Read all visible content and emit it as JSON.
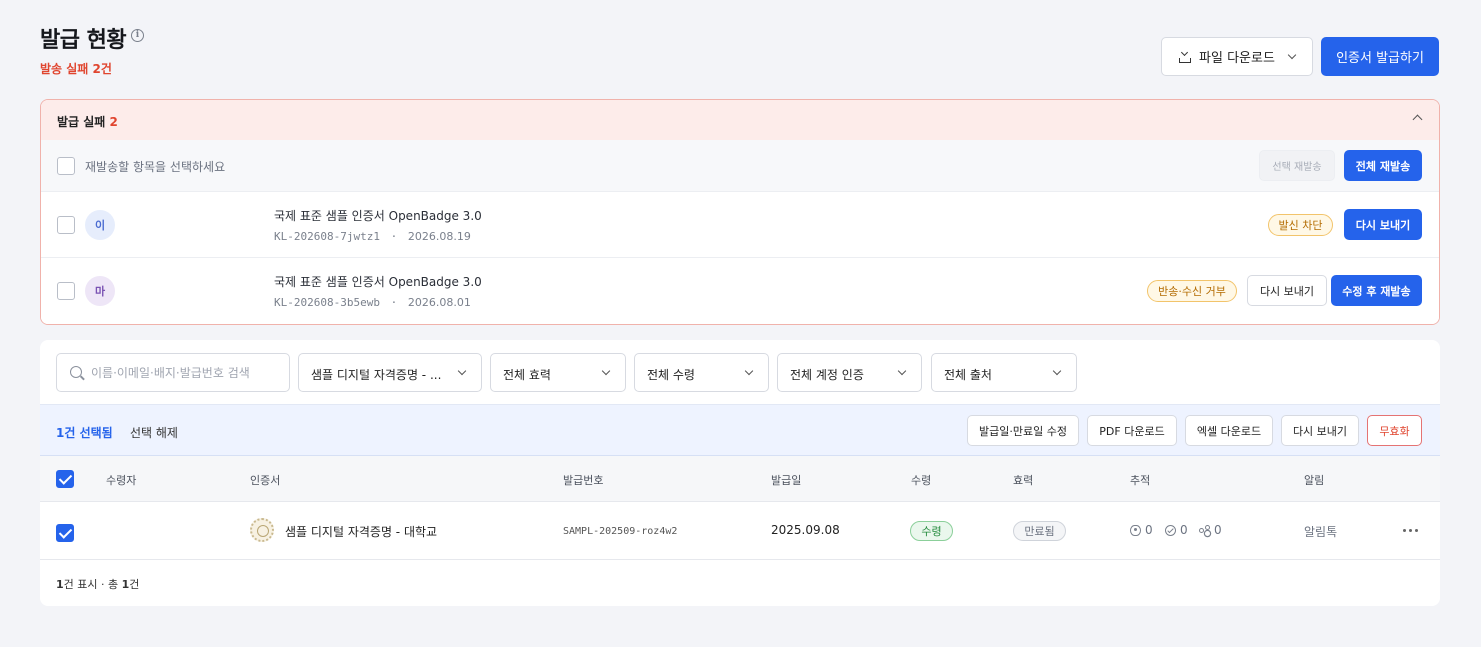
{
  "header": {
    "title": "발급 현황",
    "info_icon": "i",
    "fail_subtitle": "발송 실패 2건",
    "file_download_label": "파일 다운로드",
    "issue_button_label": "인증서 발급하기"
  },
  "fail_panel": {
    "title": "발급 실패",
    "count": "2",
    "select_prompt": "재발송할 항목을 선택하세요",
    "selected_resend_label": "선택 재발송",
    "resend_all_label": "전체 재발송",
    "rows": [
      {
        "avatar": "이",
        "cert_name": "국제 표준 샘플 인증서 OpenBadge 3.0",
        "code": "KL-202608-7jwtz1",
        "separator": "·",
        "date": "2026.08.19",
        "badge": "발신 차단",
        "action_primary": "다시 보내기"
      },
      {
        "avatar": "마",
        "cert_name": "국제 표준 샘플 인증서 OpenBadge 3.0",
        "code": "KL-202608-3b5ewb",
        "separator": "·",
        "date": "2026.08.01",
        "badge": "반송·수신 거부",
        "action_secondary": "다시 보내기",
        "action_primary": "수정 후 재발송"
      }
    ]
  },
  "filters": {
    "search_placeholder": "이름·이메일·배지·발급번호 검색",
    "dropdowns": [
      "샘플 디지털 자격증명 - ...",
      "전체 효력",
      "전체 수령",
      "전체 계정 인증",
      "전체 출처"
    ]
  },
  "selection_bar": {
    "count_label": "1건 선택됨",
    "clear_label": "선택 해제",
    "actions": [
      "발급일·만료일 수정",
      "PDF 다운로드",
      "엑셀 다운로드",
      "다시 보내기",
      "무효화"
    ]
  },
  "table": {
    "columns": [
      "수령자",
      "인증서",
      "발급번호",
      "발급일",
      "수령",
      "효력",
      "추적",
      "알림"
    ],
    "rows": [
      {
        "recipient": "",
        "certificate": "샘플 디지털 자격증명 - 대학교",
        "issue_no": "SAMPL-202509-roz4w2",
        "issue_date": "2025.09.08",
        "received": "수령",
        "validity": "만료됨",
        "views": "0",
        "verifications": "0",
        "shares": "0",
        "notification": "알림톡"
      }
    ],
    "footer_shown": "1",
    "footer_mid": "건 표시 · 총 ",
    "footer_total": "1",
    "footer_suffix": "건"
  },
  "colors": {
    "primary": "#2563eb",
    "danger": "#e0452f",
    "fail_bg": "#fdecea"
  }
}
